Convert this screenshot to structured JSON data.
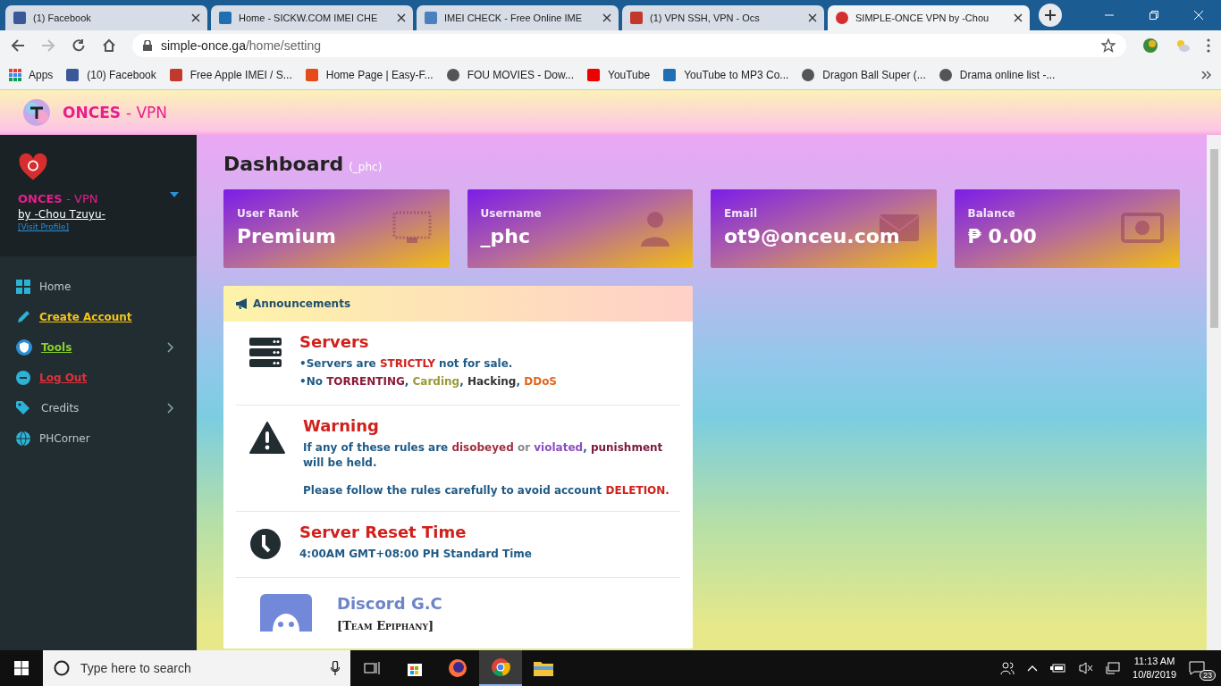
{
  "browser": {
    "tabs": [
      {
        "title": "(1) Facebook",
        "selected": false
      },
      {
        "title": "Home - SICKW.COM IMEI CHE",
        "selected": false
      },
      {
        "title": "IMEI CHECK - Free Online IME",
        "selected": false
      },
      {
        "title": "(1) VPN SSH, VPN - Ocs",
        "selected": false
      },
      {
        "title": "SIMPLE-ONCE VPN by -Chou",
        "selected": true
      }
    ],
    "address": {
      "host": "simple-once.ga",
      "path": "/home/setting"
    },
    "bookmarks": [
      "Apps",
      "(10) Facebook",
      "Free Apple IMEI / S...",
      "Home Page | Easy-F...",
      "FOU MOVIES - Dow...",
      "YouTube",
      "YouTube to MP3 Co...",
      "Dragon Ball Super (...",
      "Drama online list -..."
    ]
  },
  "header": {
    "brand": "ONCES",
    "suffix": "- VPN"
  },
  "sidebar": {
    "profile": {
      "brand": "ONCES",
      "suffix": "- VPN",
      "author": "by -Chou Tzuyu-",
      "link": "[Visit Profile]"
    },
    "items": [
      {
        "label": "Home",
        "kind": "plain",
        "expandable": false
      },
      {
        "label": "Create Account",
        "kind": "link",
        "color": "#f5c518",
        "expandable": false
      },
      {
        "label": "Tools",
        "kind": "link",
        "color": "#8bd12a",
        "expandable": true
      },
      {
        "label": "Log Out",
        "kind": "link",
        "color": "#e0303a",
        "expandable": false
      },
      {
        "label": "Credits",
        "kind": "plain",
        "expandable": true
      },
      {
        "label": "PHCorner",
        "kind": "plain",
        "expandable": false
      }
    ]
  },
  "dashboard": {
    "title": "Dashboard",
    "subtitle": "(_phc)",
    "stats": [
      {
        "label": "User Rank",
        "value": "Premium"
      },
      {
        "label": "Username",
        "value": "_phc"
      },
      {
        "label": "Email",
        "value": "ot9@onceu.com"
      },
      {
        "label": "Balance",
        "value": "₱ 0.00"
      }
    ],
    "announcements": {
      "title": "Announcements",
      "sections": [
        {
          "kind": "servers",
          "heading": "Servers",
          "paragraphs": [
            [
              {
                "text": "•Servers are ",
                "color": "#1f5a86"
              },
              {
                "text": "STRICTLY",
                "color": "#d0211c"
              },
              {
                "text": " not for sale.",
                "color": "#1f5a86"
              }
            ],
            [
              {
                "text": "•No ",
                "color": "#1f5a86"
              },
              {
                "text": "TORRENTING",
                "color": "#8b1a3a"
              },
              {
                "text": ", ",
                "color": "#1f5a86"
              },
              {
                "text": "Carding",
                "color": "#9a9a3a"
              },
              {
                "text": ", ",
                "color": "#1f5a86"
              },
              {
                "text": "Hacking",
                "color": "#333333"
              },
              {
                "text": ", ",
                "color": "#1f5a86"
              },
              {
                "text": "DDoS",
                "color": "#e0661a"
              }
            ]
          ]
        },
        {
          "kind": "warning",
          "heading": "Warning",
          "paragraphs": [
            [
              {
                "text": "If any of these rules are ",
                "color": "#1f5a86"
              },
              {
                "text": "disobeyed",
                "color": "#a03040"
              },
              {
                "text": " or ",
                "color": "#888888"
              },
              {
                "text": "violated",
                "color": "#8a4fc0"
              },
              {
                "text": ", ",
                "color": "#1f5a86"
              },
              {
                "text": "punishment",
                "color": "#7a1a40"
              },
              {
                "text": " will be held.",
                "color": "#1f5a86"
              }
            ],
            [
              {
                "text": "Please follow the rules carefully to avoid account ",
                "color": "#1f5a86"
              },
              {
                "text": "DELETION.",
                "color": "#d0211c"
              }
            ]
          ]
        },
        {
          "kind": "clock",
          "heading": "Server Reset Time",
          "paragraphs": [
            [
              {
                "text": "4:00AM GMT+08:00 PH Standard Time",
                "color": "#1f5a86"
              }
            ]
          ]
        },
        {
          "kind": "discord",
          "heading": "Discord G.C",
          "paragraphs": [
            [
              {
                "text": "[Team Epiphany]",
                "color": "#222222"
              }
            ]
          ]
        }
      ]
    }
  },
  "taskbar": {
    "search": {
      "placeholder": "Type here to search"
    },
    "time": "11:13 AM",
    "date": "10/8/2019",
    "notifications": "23"
  }
}
